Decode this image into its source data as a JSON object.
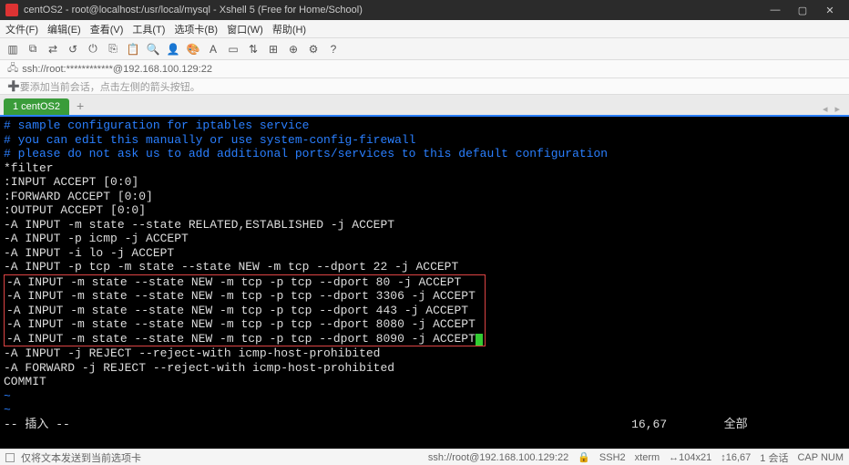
{
  "titlebar": {
    "title": "centOS2 - root@localhost:/usr/local/mysql - Xshell 5 (Free for Home/School)"
  },
  "menubar": {
    "items": [
      "文件(F)",
      "编辑(E)",
      "查看(V)",
      "工具(T)",
      "选项卡(B)",
      "窗口(W)",
      "帮助(H)"
    ]
  },
  "addressbar": {
    "text": "ssh://root:************@192.168.100.129:22"
  },
  "hintbar": {
    "text": "要添加当前会话，点击左侧的箭头按钮。"
  },
  "tab": {
    "label": "1 centOS2"
  },
  "terminal": {
    "comment1": "# sample configuration for iptables service",
    "comment2": "# you can edit this manually or use system-config-firewall",
    "comment3": "# please do not ask us to add additional ports/services to this default configuration",
    "l_filter": "*filter",
    "l_input_accept": ":INPUT ACCEPT [0:0]",
    "l_forward_accept": ":FORWARD ACCEPT [0:0]",
    "l_output_accept": ":OUTPUT ACCEPT [0:0]",
    "l_rule1": "-A INPUT -m state --state RELATED,ESTABLISHED -j ACCEPT",
    "l_rule2": "-A INPUT -p icmp -j ACCEPT",
    "l_rule3": "-A INPUT -i lo -j ACCEPT",
    "l_rule4": "-A INPUT -p tcp -m state --state NEW -m tcp --dport 22 -j ACCEPT",
    "boxed1": "-A INPUT -m state --state NEW -m tcp -p tcp --dport 80 -j ACCEPT   ",
    "boxed2": "-A INPUT -m state --state NEW -m tcp -p tcp --dport 3306 -j ACCEPT ",
    "boxed3": "-A INPUT -m state --state NEW -m tcp -p tcp --dport 443 -j ACCEPT  ",
    "boxed4": "-A INPUT -m state --state NEW -m tcp -p tcp --dport 8080 -j ACCEPT ",
    "boxed5": "-A INPUT -m state --state NEW -m tcp -p tcp --dport 8090 -j ACCEPT",
    "l_reject1": "-A INPUT -j REJECT --reject-with icmp-host-prohibited",
    "l_reject2": "-A FORWARD -j REJECT --reject-with icmp-host-prohibited",
    "l_commit": "COMMIT",
    "tilde": "~",
    "vim_mode": "-- 插入 --",
    "vim_pos": "16,67",
    "vim_scroll": "全部"
  },
  "statusbar": {
    "left_text": "仅将文本发送到当前选项卡",
    "conn": "ssh://root@192.168.100.129:22",
    "proto": "SSH2",
    "term": "xterm",
    "size": "104x21",
    "pos": "16,67",
    "sessions": "1 会话",
    "caps": "CAP  NUM"
  }
}
